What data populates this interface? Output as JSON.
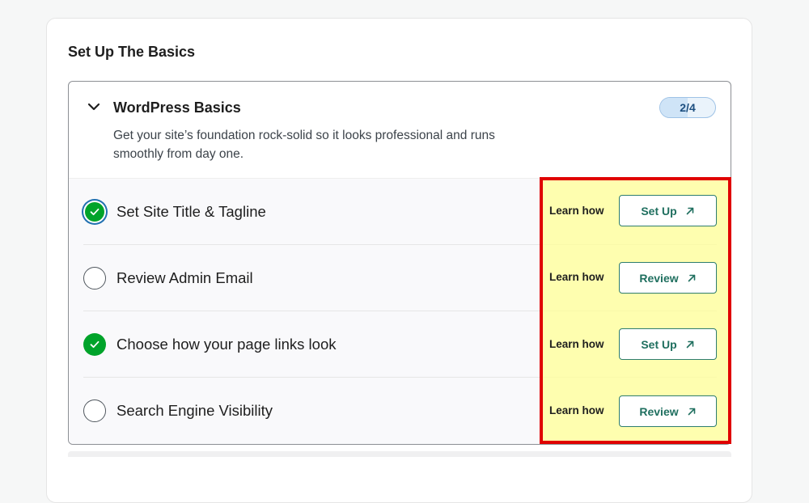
{
  "section": {
    "title": "Set Up The Basics"
  },
  "card": {
    "title": "WordPress Basics",
    "description": "Get your site’s foundation rock-solid so it looks professional and runs smoothly from day one.",
    "progress": {
      "label": "2/4",
      "completed": 2,
      "total": 4
    }
  },
  "tasks": [
    {
      "label": "Set Site Title & Tagline",
      "done": true,
      "learn_label": "Learn how",
      "action_label": "Set Up"
    },
    {
      "label": "Review Admin Email",
      "done": false,
      "learn_label": "Learn how",
      "action_label": "Review"
    },
    {
      "label": "Choose how your page links look",
      "done": true,
      "learn_label": "Learn how",
      "action_label": "Set Up"
    },
    {
      "label": "Search Engine Visibility",
      "done": false,
      "learn_label": "Learn how",
      "action_label": "Review"
    }
  ],
  "icons": {
    "collapse": "chevron-down-icon",
    "check": "check-icon",
    "external": "arrow-up-right-icon"
  },
  "colors": {
    "accent": "#1f6f5f",
    "success": "#00a32a",
    "highlight_border": "#e00000",
    "highlight_fill": "#ffff96",
    "badge": "#1d4f80"
  }
}
